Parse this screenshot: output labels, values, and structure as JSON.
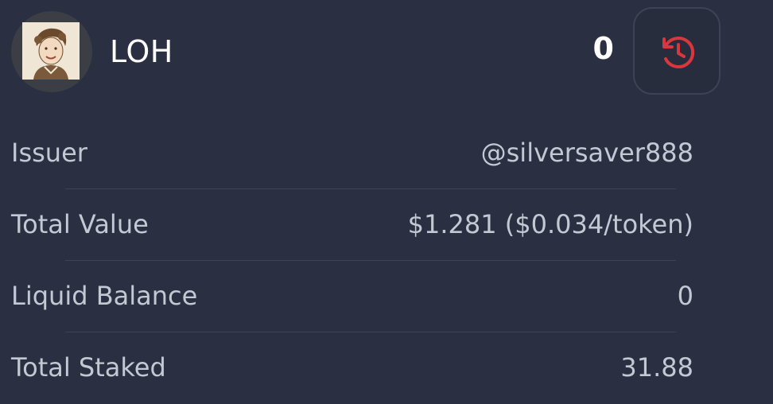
{
  "token": {
    "name": "LOH",
    "count": "0"
  },
  "colors": {
    "background": "#2a3042",
    "label": "#c3c8d3",
    "accent_history": "#d9363e"
  },
  "icons": {
    "avatar": "token-avatar-image",
    "history": "history-icon"
  },
  "details": [
    {
      "label": "Issuer",
      "value": "@silversaver888"
    },
    {
      "label": "Total Value",
      "value": "$1.281 ($0.034/token)"
    },
    {
      "label": "Liquid Balance",
      "value": "0"
    },
    {
      "label": "Total Staked",
      "value": "31.88"
    }
  ]
}
